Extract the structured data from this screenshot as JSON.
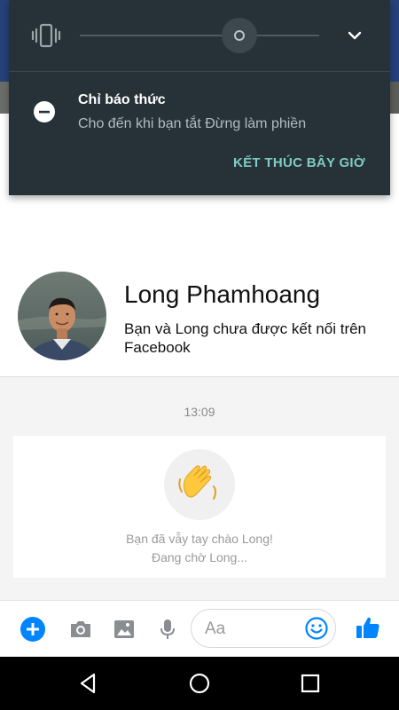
{
  "dnd_panel": {
    "title": "Chỉ báo thức",
    "subtitle": "Cho đến khi bạn tắt Đừng làm phiền",
    "end_now_label": "KẾT THÚC BÂY GIỜ",
    "volume_icon": "vibrate-icon",
    "expand_icon": "chevron-down-icon",
    "mode_icon": "minus-circle-icon"
  },
  "profile": {
    "name": "Long Phamhoang",
    "description": "Bạn và Long chưa được kết nối trên Facebook"
  },
  "conversation": {
    "timestamp": "13:09",
    "wave_message": "Bạn đã vẫy tay chào Long!",
    "waiting_message": "Đang chờ Long...",
    "wave_icon": "waving-hand-icon"
  },
  "composer": {
    "placeholder": "Aa",
    "icons": [
      "plus-icon",
      "camera-icon",
      "image-icon",
      "microphone-icon",
      "emoji-icon",
      "thumbs-up-icon"
    ]
  },
  "navbar": {
    "icons": [
      "back-icon",
      "home-icon",
      "recents-icon"
    ]
  },
  "colors": {
    "panel_bg": "#263238",
    "accent_teal": "#80cbc4",
    "messenger_blue": "#0084ff",
    "wave_yellow": "#ffc83d"
  }
}
